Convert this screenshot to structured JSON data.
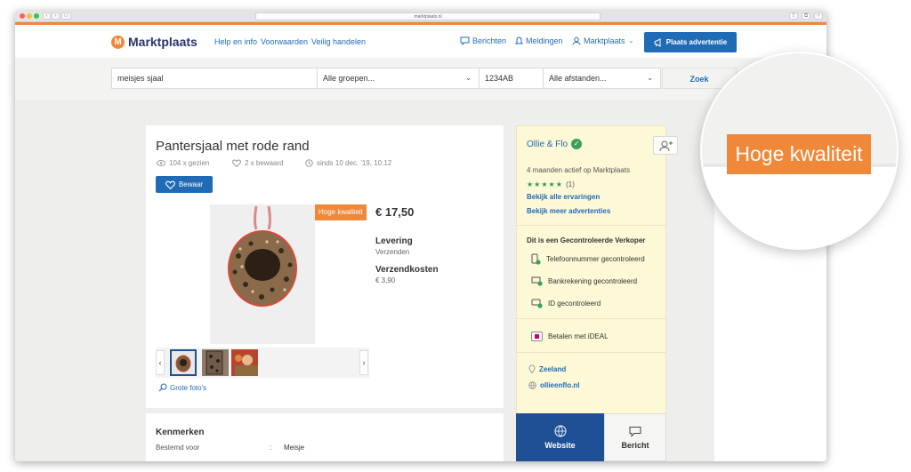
{
  "browser": {
    "url": "marktplaats.nl"
  },
  "nav": {
    "logo": "Marktplaats",
    "logo_mark": "M",
    "links": [
      "Help en info",
      "Voorwaarden",
      "Veilig handelen"
    ],
    "berichten": "Berichten",
    "meldingen": "Meldingen",
    "account": "Marktplaats",
    "place_ad": "Plaats advertentie"
  },
  "search": {
    "query": "meisjes sjaal",
    "group": "Alle groepen...",
    "postcode": "1234AB",
    "distance": "Alle afstanden...",
    "button": "Zoek"
  },
  "listing": {
    "title": "Pantersjaal met rode rand",
    "views": "104 x gezien",
    "saved": "2 x bewaard",
    "since": "sinds 10 dec. '19, 10:12",
    "save_button": "Bewaar",
    "badge": "Hoge kwaliteit",
    "price": "€ 17,50",
    "levering_label": "Levering",
    "levering_value": "Verzenden",
    "verzendkosten_label": "Verzendkosten",
    "verzendkosten_value": "€ 3,90",
    "large_photos": "Grote foto's",
    "kenmerken_title": "Kenmerken",
    "spec_key": "Bestemd voor",
    "spec_colon": ":",
    "spec_value": "Meisje"
  },
  "seller": {
    "name": "Ollie & Flo",
    "active": "4 maanden actief op Marktplaats",
    "stars": "★★★★★",
    "review_count": "(1)",
    "all_reviews": "Bekijk alle ervaringen",
    "more_ads": "Bekijk meer advertenties",
    "verified_heading": "Dit is een Gecontroleerde Verkoper",
    "phone": "Telefoonnummer gecontroleerd",
    "bank": "Bankrekening gecontroleerd",
    "id": "ID gecontroleerd",
    "ideal": "Betalen met iDEAL",
    "location": "Zeeland",
    "website_url": "ollieenflo.nl",
    "website_button": "Website",
    "message_button": "Bericht"
  },
  "magnifier": {
    "badge": "Hoge kwaliteit"
  },
  "colors": {
    "brand_blue": "#1f6bb6",
    "brand_navy": "#27356b",
    "accent_orange": "#f0883a",
    "seller_bg": "#fdf8d6",
    "verified_green": "#3aa15a"
  }
}
